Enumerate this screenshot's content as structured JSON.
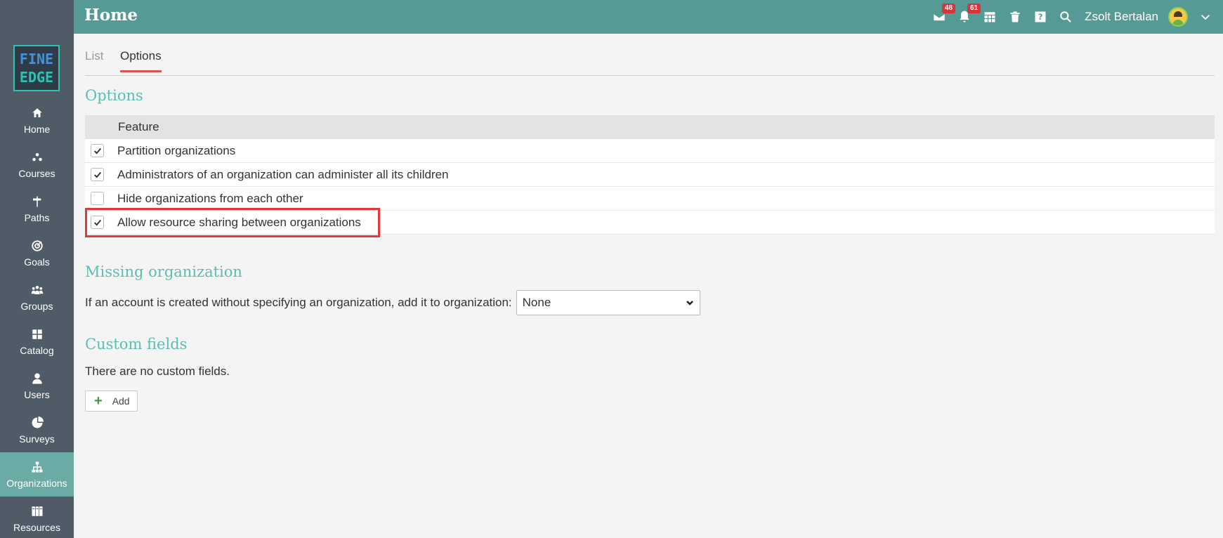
{
  "header": {
    "title": "Home",
    "messages_badge": "48",
    "notifications_badge": "61",
    "user_name": "Zsolt Bertalan"
  },
  "logo": {
    "line1": "FINE",
    "line2": "EDGE"
  },
  "sidebar": {
    "items": [
      {
        "label": "Home",
        "icon": "home-icon"
      },
      {
        "label": "Courses",
        "icon": "courses-icon"
      },
      {
        "label": "Paths",
        "icon": "signpost-icon"
      },
      {
        "label": "Goals",
        "icon": "target-icon"
      },
      {
        "label": "Groups",
        "icon": "groups-icon"
      },
      {
        "label": "Catalog",
        "icon": "grid-icon"
      },
      {
        "label": "Users",
        "icon": "user-icon"
      },
      {
        "label": "Surveys",
        "icon": "pie-icon"
      },
      {
        "label": "Organizations",
        "icon": "org-chart-icon"
      },
      {
        "label": "Resources",
        "icon": "books-icon"
      }
    ],
    "active": "Organizations"
  },
  "tabs": {
    "list": "List",
    "options": "Options"
  },
  "options": {
    "heading": "Options",
    "column_header": "Feature",
    "rows": [
      {
        "label": "Partition organizations",
        "checked": true
      },
      {
        "label": "Administrators of an organization can administer all its children",
        "checked": true
      },
      {
        "label": "Hide organizations from each other",
        "checked": false
      },
      {
        "label": "Allow resource sharing between organizations",
        "checked": true
      }
    ]
  },
  "missing": {
    "heading": "Missing organization",
    "text": "If an account is created without specifying an organization, add it to organization:",
    "selected": "None"
  },
  "custom": {
    "heading": "Custom fields",
    "empty_text": "There are no custom fields.",
    "add_label": "Add"
  },
  "colors": {
    "topbar": "#559a94",
    "sidebar": "#4f5b66",
    "accent": "#5bbdb3",
    "highlight": "#e3393c"
  }
}
